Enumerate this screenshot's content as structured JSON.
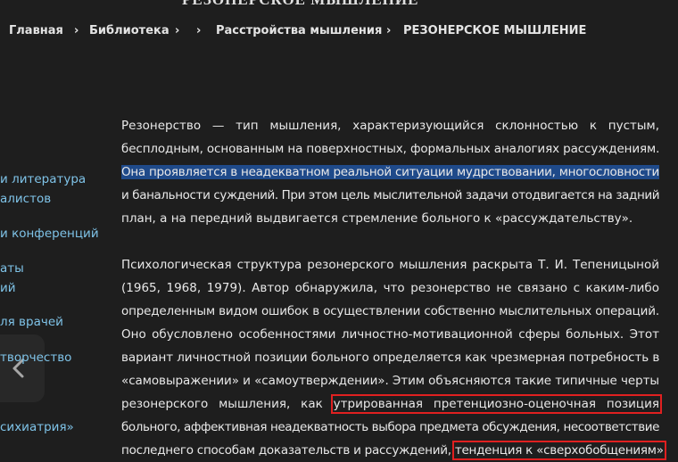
{
  "page": {
    "top_title": "РЕЗОНЕРСКОЕ МЫШЛЕНИЕ"
  },
  "breadcrumb": {
    "home": "Главная",
    "library": "Библиотека",
    "section": "Расстройства мышления",
    "current": "РЕЗОНЕРСКОЕ МЫШЛЕНИЕ",
    "separator": "›"
  },
  "sidebar": {
    "items": [
      {
        "lines": [
          "и литература",
          "алистов"
        ]
      },
      {
        "lines": [
          "и конференций"
        ]
      },
      {
        "lines": [
          "аты",
          "ий"
        ]
      },
      {
        "lines": [
          "ля врачей"
        ]
      },
      {
        "lines": [
          "творчество"
        ]
      },
      {
        "lines": [
          "сихиатрия»"
        ]
      }
    ]
  },
  "article": {
    "p1": [
      "Резонерство — тип мышления, характеризующийся склонностью к пустым,",
      "бесплодным, основанным на поверхностных, формальных аналогиях рассуждениям.",
      "Она проявляется в неадекватном реальной ситуации мудрствовании, многословности",
      "и банальности суждений. При этом цель мыслительной задачи отодвигается на задний",
      "план, а на передний выдвигается стремление больного к «рассуждательству»."
    ],
    "p2": [
      "Психологическая структура резонерского мышления раскрыта Т. И. Тепеницыной",
      "(1965, 1968, 1979). Автор обнаружила, что резонерство не связано с каким-либо",
      "определенным видом ошибок в осуществлении собственно мыслительных операций.",
      "Оно обусловлено особенностями личностно-мотивационной сферы больных. Этот",
      "вариант личностной позиции больного определяется как чрезмерная потребность в",
      "«самовыражении» и «самоутверждении». Этим объясняются такие типичные черты"
    ],
    "p2_line7_prefix": "резонерского мышления, как",
    "p2_line7_boxed": "утрированная претенциозно-оценочная позиция",
    "p2_line8": "больного, аффективная неадекватность выбора предмета обсуждения, несоответствие",
    "p2_line9_prefix": "последнего способам доказательств и рассуждений,",
    "p2_line9_boxed": "тенденция к «сверхобобщениям»"
  },
  "colors": {
    "background": "#1e1e1e",
    "link": "#7fc3e8",
    "highlight": "#1f4a8a",
    "annotation_box": "#e02020"
  }
}
